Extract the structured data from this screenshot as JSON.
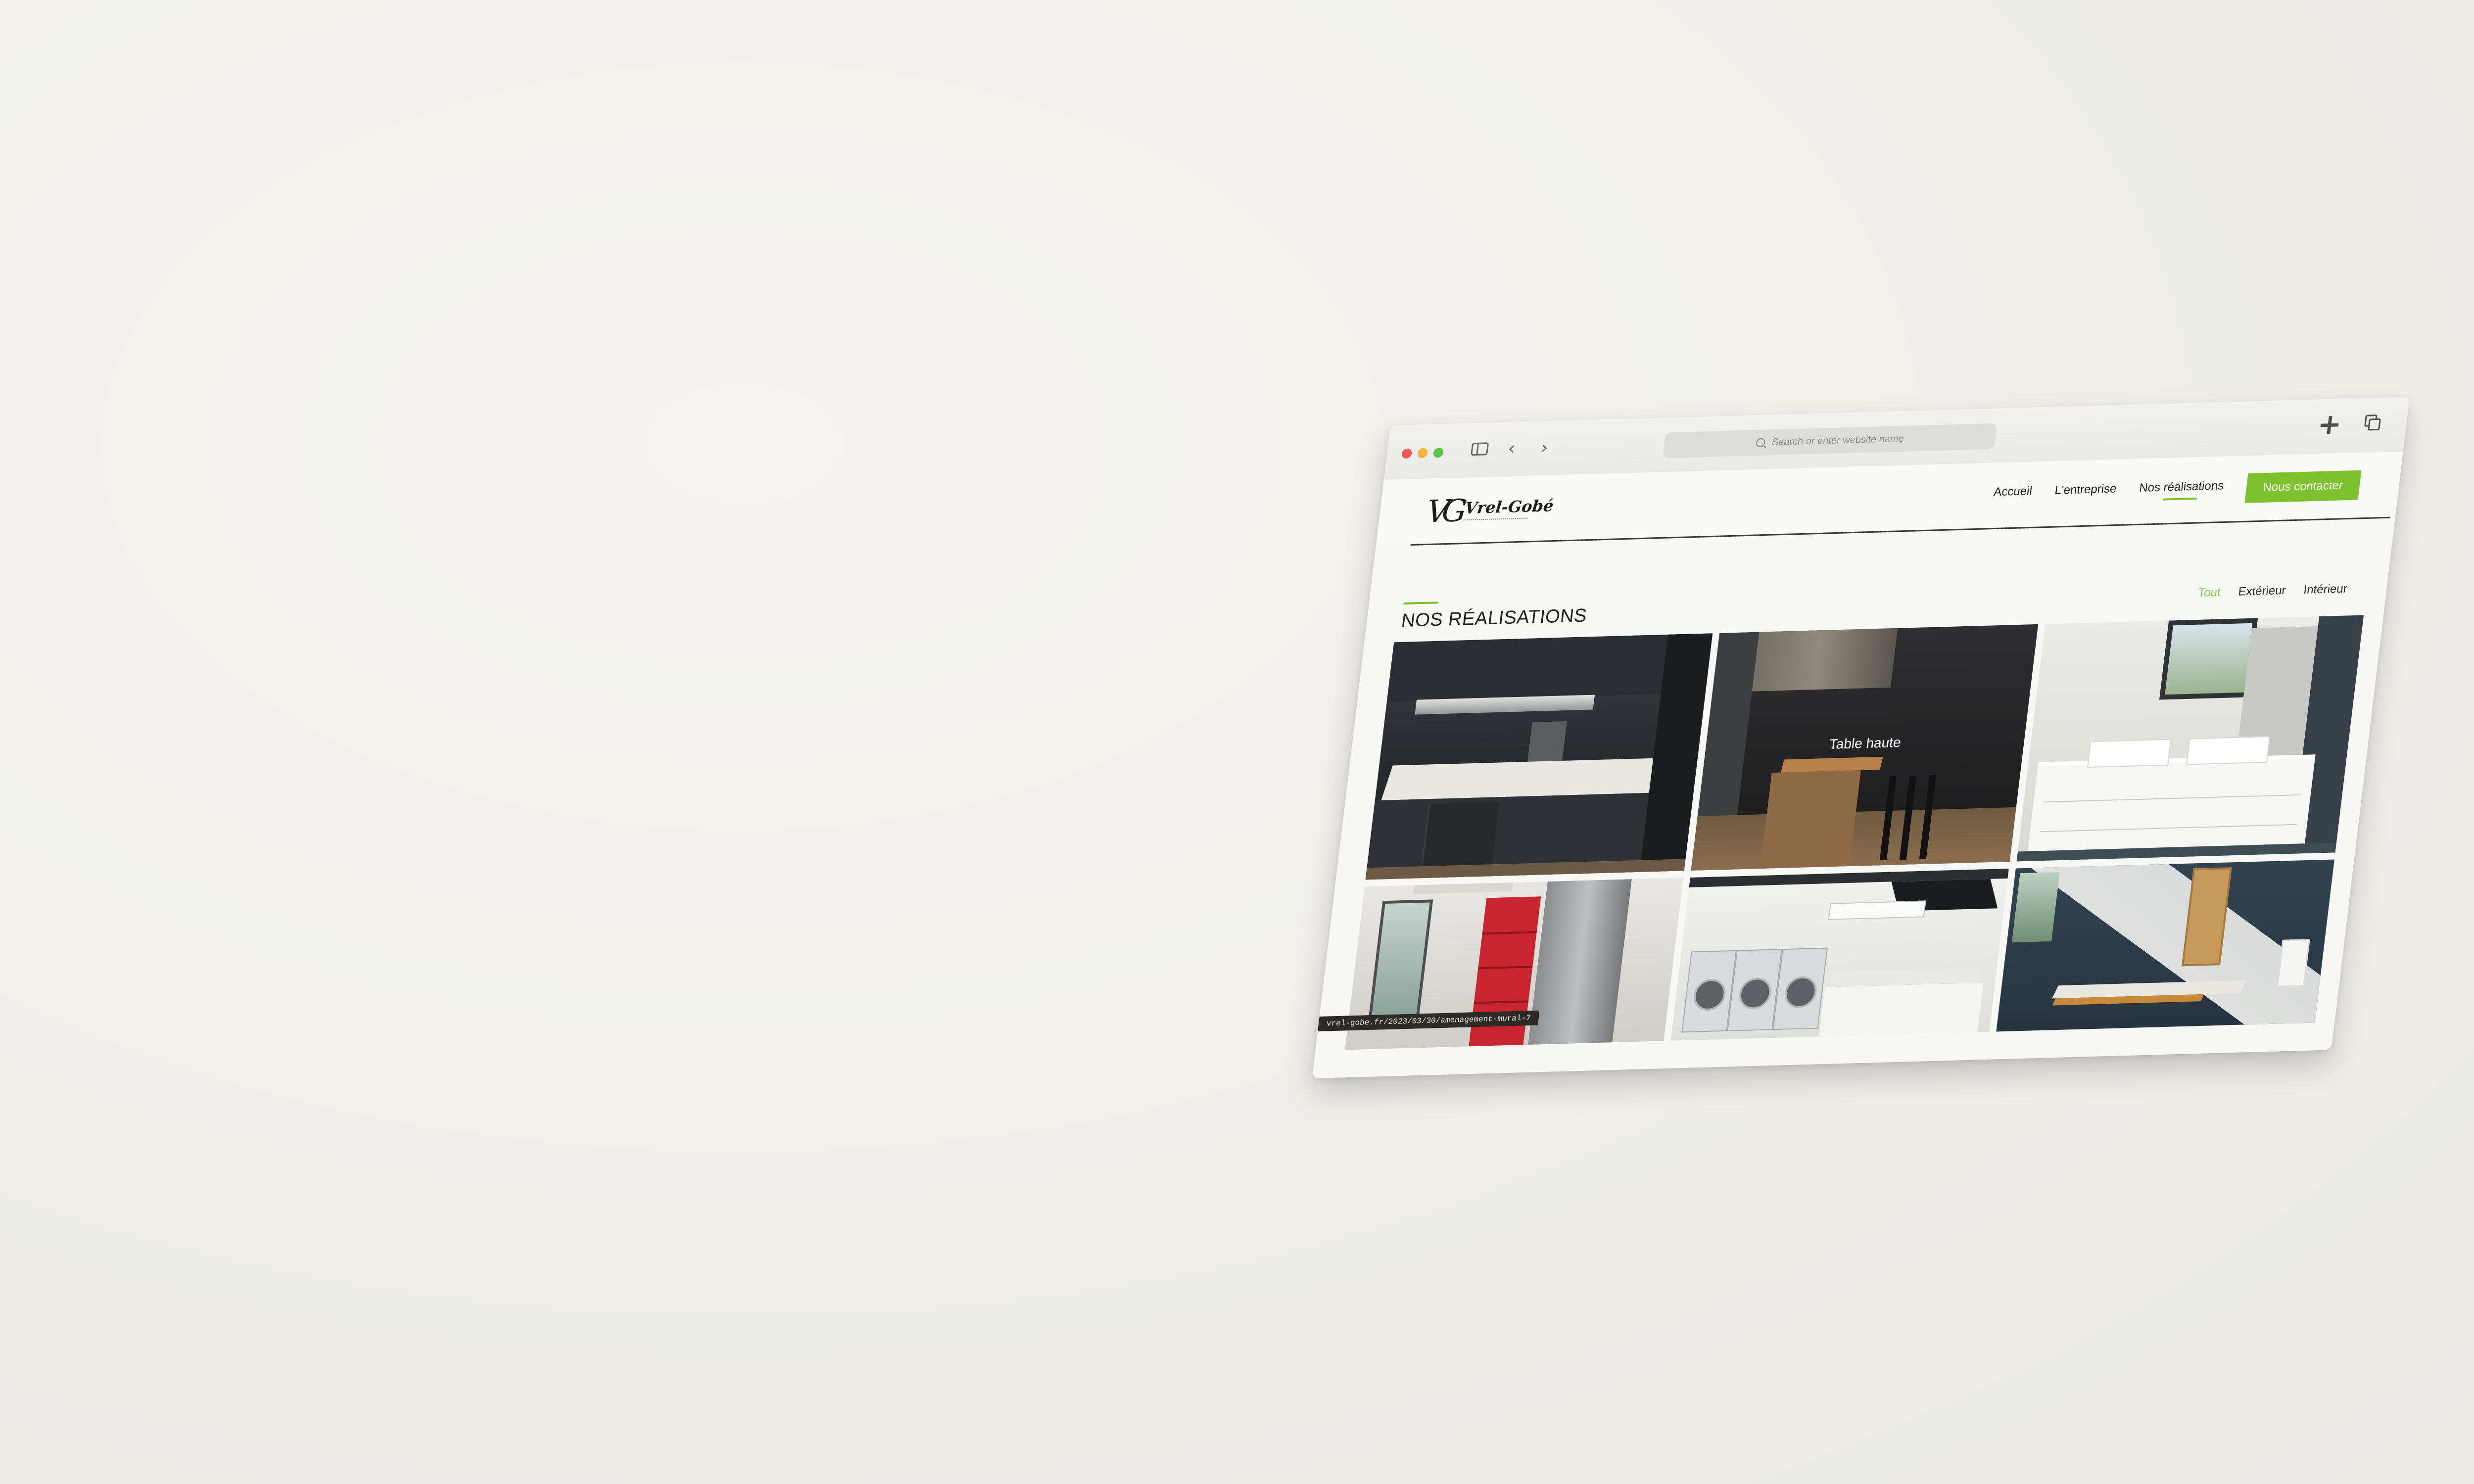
{
  "browser": {
    "address_placeholder": "Search or enter website name",
    "icons": [
      "close-window",
      "minimize-window",
      "zoom-window",
      "sidebar",
      "back",
      "forward",
      "search",
      "plus",
      "tabs-overview"
    ]
  },
  "site": {
    "logo": {
      "mark": "VG",
      "name": "Vrel-Gobé"
    },
    "nav": {
      "items": [
        "Accueil",
        "L'entreprise",
        "Nos réalisations"
      ],
      "active": "Nos réalisations",
      "cta": "Nous contacter"
    },
    "colors": {
      "accent": "#7cc12e",
      "text": "#1f1f1f"
    }
  },
  "realisations": {
    "title": "NOS RÉALISATIONS",
    "filters": [
      "Tout",
      "Extérieur",
      "Intérieur"
    ],
    "active_filter": "Tout",
    "tiles": [
      {
        "caption": "",
        "icon": "kitchen-photo"
      },
      {
        "caption": "Table haute",
        "icon": "bar-table-photo"
      },
      {
        "caption": "",
        "icon": "bathroom-photo"
      },
      {
        "caption": "",
        "icon": "shelves-photo"
      },
      {
        "caption": "",
        "icon": "laundry-photo"
      },
      {
        "caption": "",
        "icon": "office-photo"
      }
    ]
  },
  "status_bar": {
    "link": "vrel-gobe.fr/2023/03/30/amenagement-mural-7"
  }
}
